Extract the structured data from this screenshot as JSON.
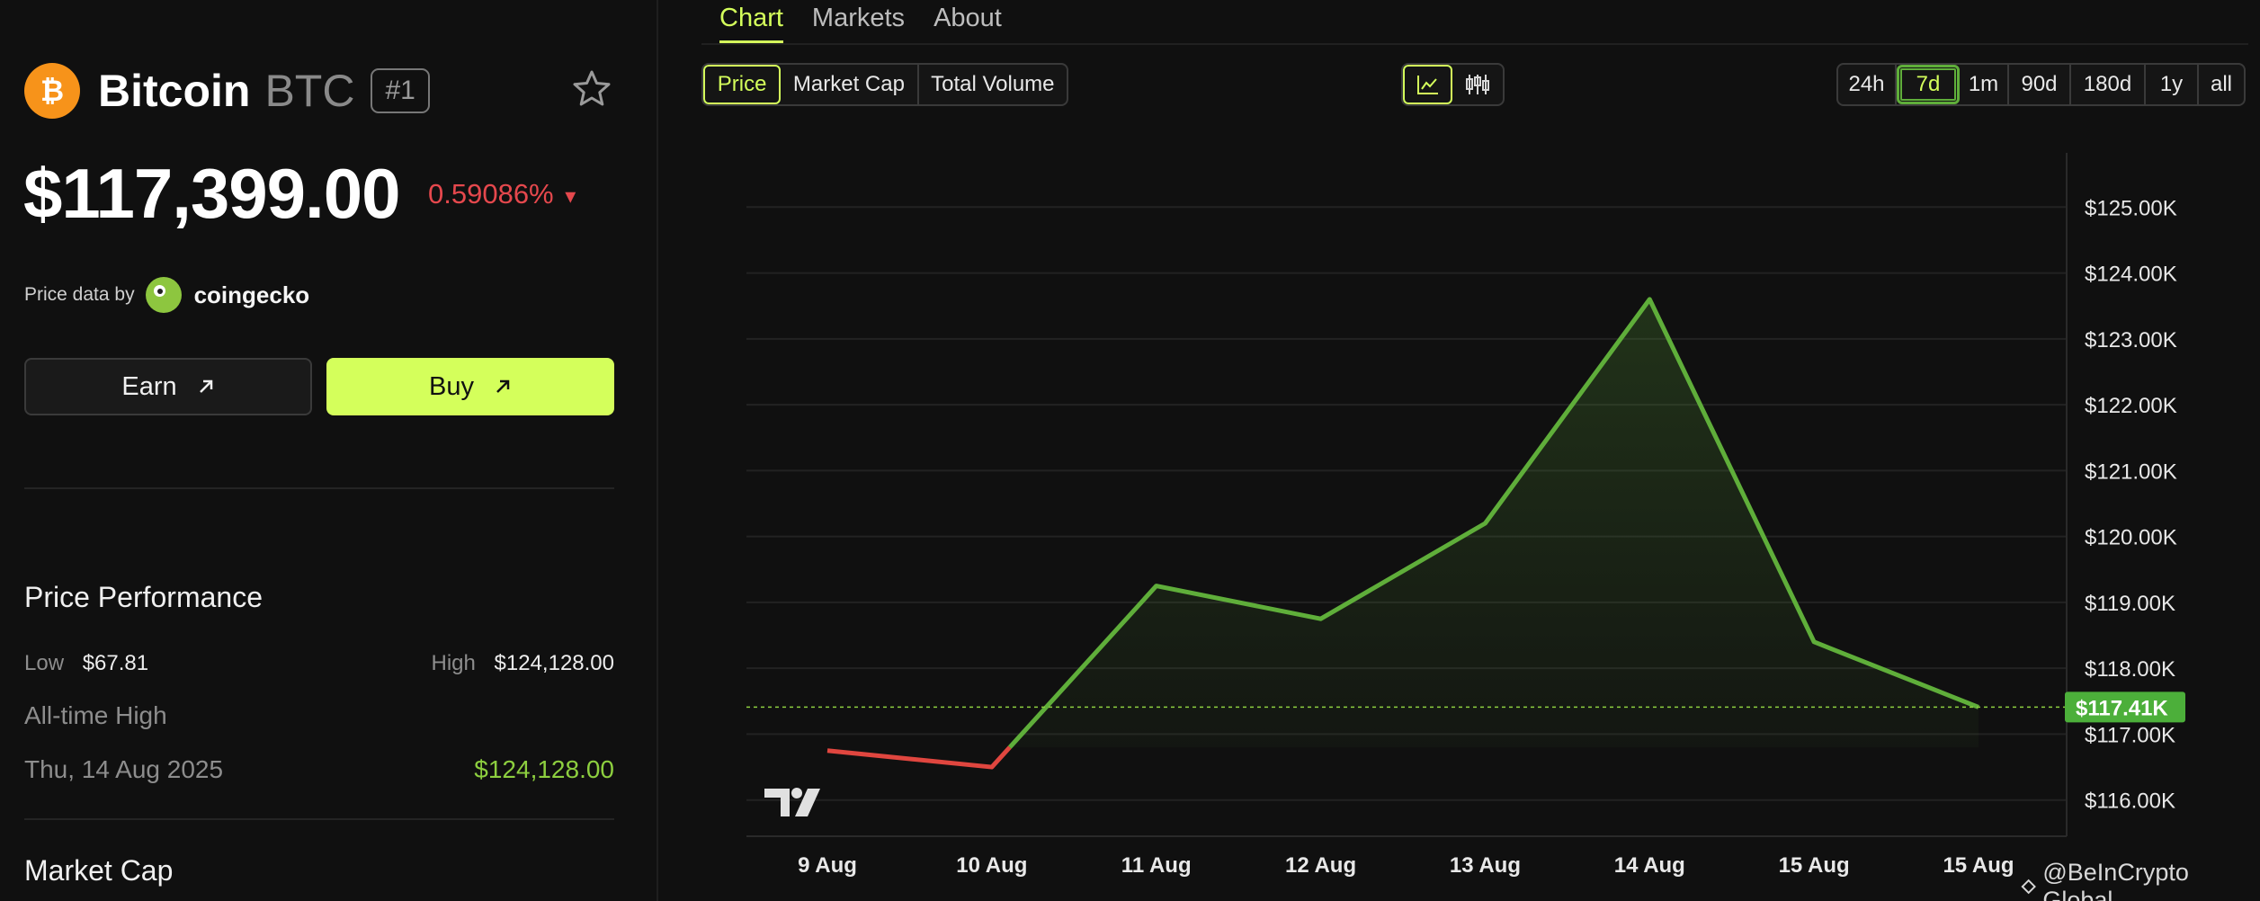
{
  "coin": {
    "name": "Bitcoin",
    "symbol": "BTC",
    "rank": "#1",
    "price": "$117,399.00",
    "change": "0.59086%",
    "change_arrow": "▾",
    "brand_color": "#f7931a"
  },
  "price_data": {
    "label": "Price data by",
    "provider": "coingecko"
  },
  "actions": {
    "earn": "Earn",
    "buy": "Buy",
    "buy_color": "#d4ff5b"
  },
  "performance": {
    "title": "Price Performance",
    "low_label": "Low",
    "low_value": "$67.81",
    "high_label": "High",
    "high_value": "$124,128.00",
    "ath_label": "All-time High",
    "ath_date": "Thu, 14 Aug 2025",
    "ath_value": "$124,128.00"
  },
  "market_cap": {
    "title": "Market Cap"
  },
  "tabs": [
    {
      "label": "Chart",
      "active": true
    },
    {
      "label": "Markets",
      "active": false
    },
    {
      "label": "About",
      "active": false
    }
  ],
  "metric_toggle": [
    {
      "label": "Price",
      "active": true
    },
    {
      "label": "Market Cap",
      "active": false
    },
    {
      "label": "Total Volume",
      "active": false
    }
  ],
  "chart_type_toggle": [
    {
      "icon": "line-chart-icon",
      "active": true
    },
    {
      "icon": "candlestick-icon",
      "active": false
    }
  ],
  "ranges": [
    {
      "label": "24h",
      "active": false
    },
    {
      "label": "7d",
      "active": true
    },
    {
      "label": "1m",
      "active": false
    },
    {
      "label": "90d",
      "active": false
    },
    {
      "label": "180d",
      "active": false
    },
    {
      "label": "1y",
      "active": false
    },
    {
      "label": "all",
      "active": false
    }
  ],
  "watermark": "@BeInCrypto Global",
  "chart_data": {
    "type": "line",
    "x": [
      "9 Aug",
      "10 Aug",
      "11 Aug",
      "12 Aug",
      "13 Aug",
      "14 Aug",
      "15 Aug",
      "15 Aug"
    ],
    "x_ticks": [
      "9 Aug",
      "10 Aug",
      "11 Aug",
      "12 Aug",
      "13 Aug",
      "14 Aug",
      "15 Aug",
      "15 Aug"
    ],
    "values": [
      116.75,
      116.5,
      119.25,
      118.75,
      120.2,
      123.6,
      118.4,
      117.41
    ],
    "unit": "thousand USD",
    "ylim": [
      115.45,
      125.55
    ],
    "y_ticks": [
      125,
      124,
      123,
      122,
      121,
      120,
      119,
      118,
      117,
      116
    ],
    "y_tick_labels": [
      "$125.00K",
      "$124.00K",
      "$123.00K",
      "$122.00K",
      "$121.00K",
      "$120.00K",
      "$119.00K",
      "$118.00K",
      "$117.00K",
      "$116.00K"
    ],
    "current_value": 117.41,
    "current_label": "$117.41K",
    "baseline": 116.8,
    "up_color": "#5fae3a",
    "down_color": "#e0463f",
    "grid": true,
    "title": "",
    "xlabel": "",
    "ylabel": ""
  }
}
